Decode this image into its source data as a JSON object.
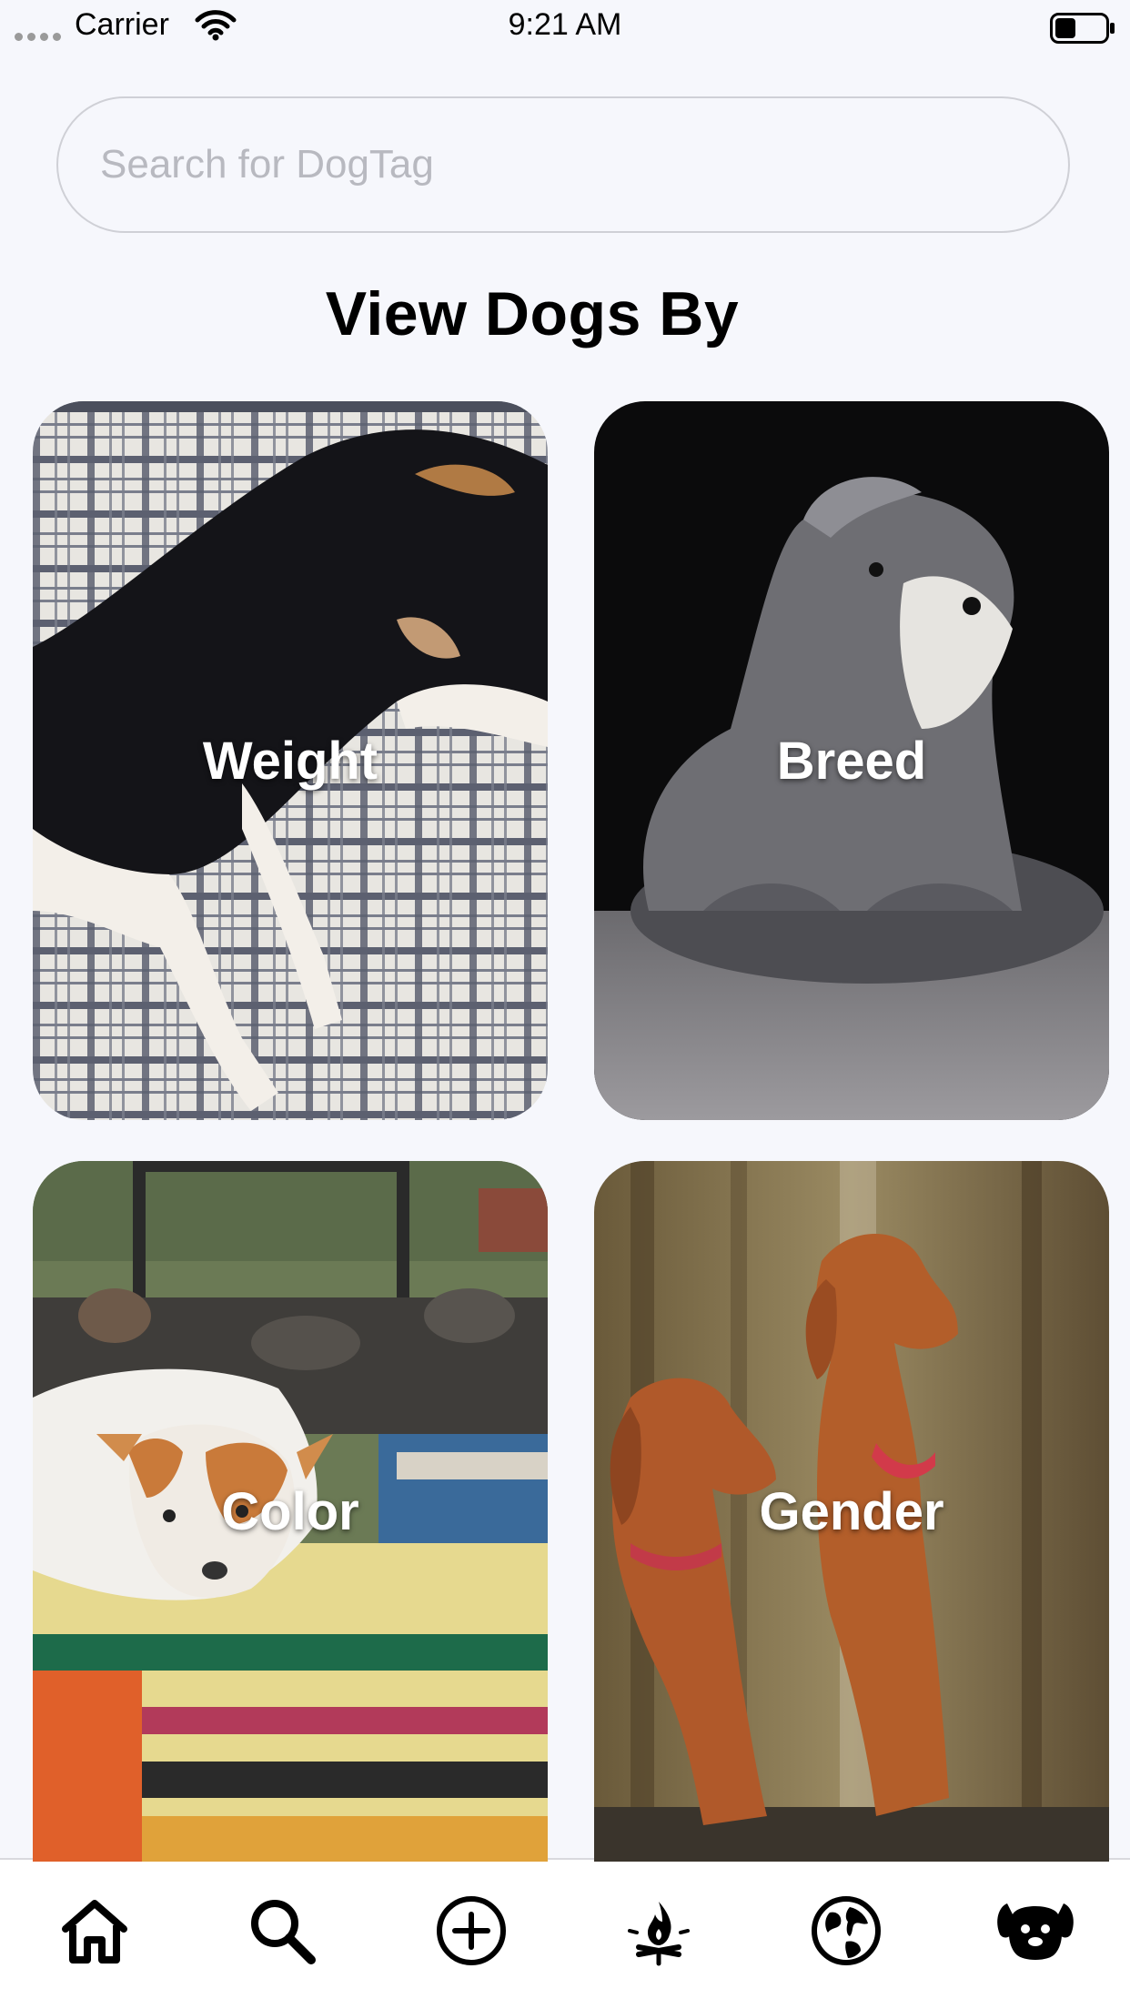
{
  "status_bar": {
    "carrier": "Carrier",
    "time": "9:21 AM"
  },
  "search": {
    "placeholder": "Search for DogTag"
  },
  "title": "View Dogs By",
  "tiles": [
    {
      "label": "Weight"
    },
    {
      "label": "Breed"
    },
    {
      "label": "Color"
    },
    {
      "label": "Gender"
    }
  ],
  "tab_bar": {
    "icons": [
      "home-icon",
      "search-icon",
      "add-circle-icon",
      "campfire-icon",
      "globe-icon",
      "dog-icon"
    ]
  }
}
